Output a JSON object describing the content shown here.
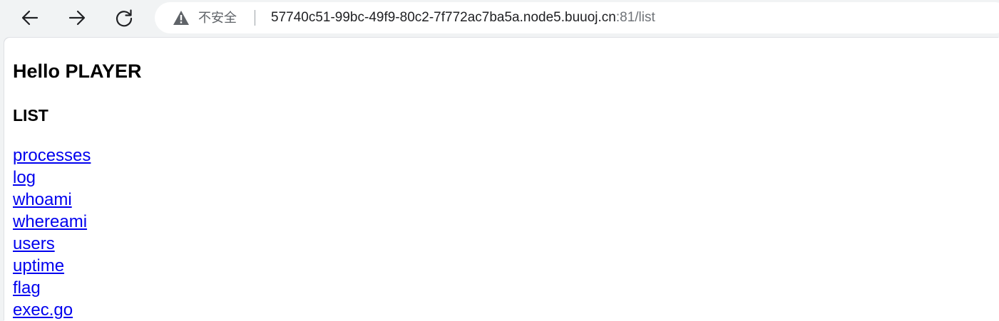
{
  "browser": {
    "security_label": "不安全",
    "url_host": "57740c51-99bc-49f9-80c2-7f772ac7ba5a.node5.buuoj.cn",
    "url_rest": ":81/list",
    "icons": {
      "back": "arrow-left-icon",
      "forward": "arrow-right-icon",
      "reload": "reload-icon",
      "warning": "warning-triangle-icon"
    }
  },
  "page": {
    "greeting": "Hello PLAYER",
    "section_title": "LIST",
    "links": [
      "processes",
      "log",
      "whoami",
      "whereami",
      "users",
      "uptime",
      "flag",
      "exec.go"
    ],
    "link_color": "#0000ee"
  }
}
